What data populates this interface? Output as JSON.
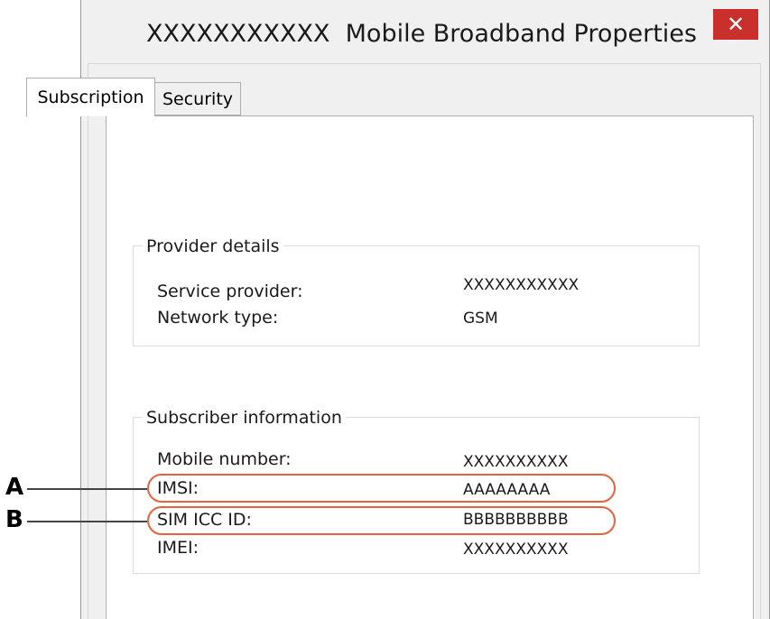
{
  "window": {
    "title": "XXXXXXXXXXX  Mobile Broadband Properties",
    "close_glyph": "✕"
  },
  "tabs": [
    {
      "label": "Subscription",
      "active": true
    },
    {
      "label": "Security",
      "active": false
    }
  ],
  "provider_details": {
    "legend": "Provider details",
    "rows": [
      {
        "label": "Service provider:",
        "value": "XXXXXXXXXXX"
      },
      {
        "label": "Network type:",
        "value": "GSM"
      }
    ]
  },
  "subscriber_information": {
    "legend": "Subscriber information",
    "rows": [
      {
        "label": "Mobile number:",
        "value": "XXXXXXXXXX"
      },
      {
        "label": "IMSI:",
        "value": "AAAAAAAA"
      },
      {
        "label": "SIM ICC ID:",
        "value": "BBBBBBBBBB"
      },
      {
        "label": "IMEI:",
        "value": "XXXXXXXXXX"
      }
    ]
  },
  "annotations": [
    {
      "marker": "A",
      "target": "IMSI:"
    },
    {
      "marker": "B",
      "target": "SIM ICC ID:"
    }
  ],
  "colors": {
    "close_button": "#c9302c",
    "callout": "#e8613c"
  }
}
